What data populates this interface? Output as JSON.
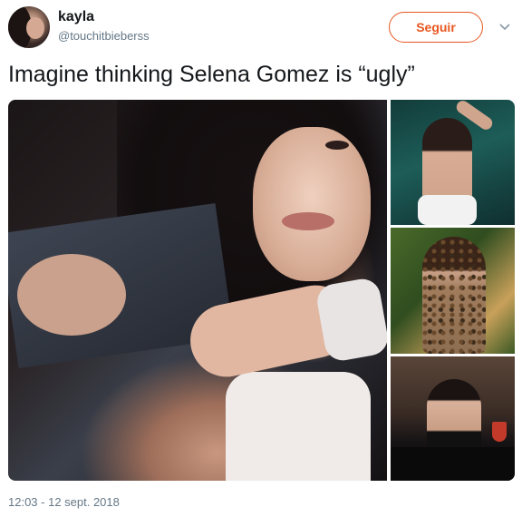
{
  "user": {
    "name": "kayla",
    "handle": "@touchitbieberss",
    "avatar_icon": "avatar"
  },
  "actions": {
    "follow_label": "Seguir",
    "menu_icon": "chevron-down-icon"
  },
  "tweet": {
    "text": "Imagine thinking Selena Gomez is “ugly”",
    "timestamp": "12:03 - 12 sept. 2018"
  },
  "colors": {
    "accent": "#e8561f",
    "secondary_text": "#657786",
    "primary_text": "#14171a"
  }
}
